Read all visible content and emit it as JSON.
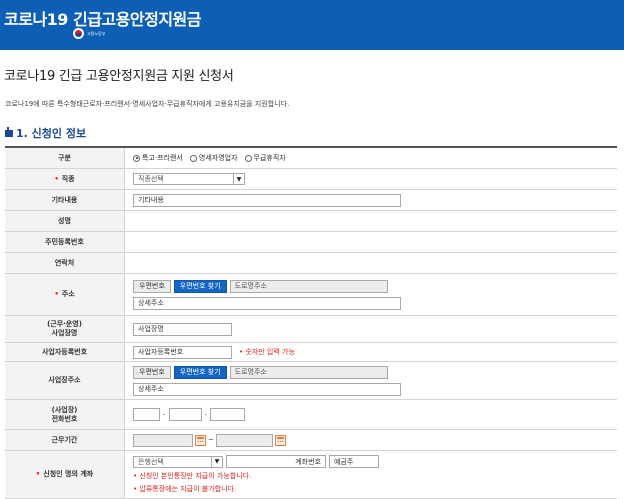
{
  "banner": {
    "title": "코로나19 긴급고용안정지원금",
    "ministry": "고용노동부"
  },
  "page": {
    "title": "코로나19 긴급 고용안정지원금 지원 신청서",
    "intro": "코로나19에 따른 특수형태근로자·프리랜서·영세사업자·무급휴직자에게 고용유지금을 지원합니다."
  },
  "section": {
    "title": "1. 신청인 정보"
  },
  "form": {
    "required_mark": "•",
    "type": {
      "label": "구분",
      "options": [
        "특고·프리랜서",
        "영세자영업자",
        "무급휴직자"
      ],
      "selected": "특고·프리랜서"
    },
    "job": {
      "label": "직종",
      "placeholder": "직종선택"
    },
    "other": {
      "label": "기타내용",
      "placeholder": "기타내용"
    },
    "name": {
      "label": "성명"
    },
    "rrn": {
      "label": "주민등록번호"
    },
    "contact": {
      "label": "연락처"
    },
    "address": {
      "label": "주소",
      "postcode_placeholder": "우편번호",
      "find_button": "우편번호 찾기",
      "road_placeholder": "도로명주소",
      "detail_placeholder": "상세주소"
    },
    "workplace_name": {
      "label_line1": "(근무·운영)",
      "label_line2": "사업장명",
      "placeholder": "사업장명"
    },
    "biz_number": {
      "label": "사업자등록번호",
      "placeholder": "사업자등록번호",
      "hint": "숫자만 입력 가능"
    },
    "workplace_address": {
      "label": "사업장주소",
      "postcode_placeholder": "우편번호",
      "find_button": "우편번호 찾기",
      "road_placeholder": "도로명주소",
      "detail_placeholder": "상세주소"
    },
    "workplace_phone": {
      "label_line1": "(사업장)",
      "label_line2": "전화번호",
      "dash": "-"
    },
    "work_period": {
      "label": "근무기간",
      "tilde": "~"
    },
    "account": {
      "label": "신청인 명의 계좌",
      "bank_placeholder": "은행선택",
      "account_placeholder": "계좌번호",
      "holder_placeholder": "예금주",
      "notice1": "신청인 본인통장만 지급이 가능합니다.",
      "notice2": "압류통장에는 지급이 불가합니다."
    }
  },
  "colors": {
    "banner": "#0d5fb5",
    "section": "#1a4a96",
    "primary_button": "#1266c6",
    "required": "#e02020"
  },
  "icons": {
    "calendar": "calendar-icon",
    "select": "chevron-down-icon",
    "radio": "radio-icon"
  }
}
